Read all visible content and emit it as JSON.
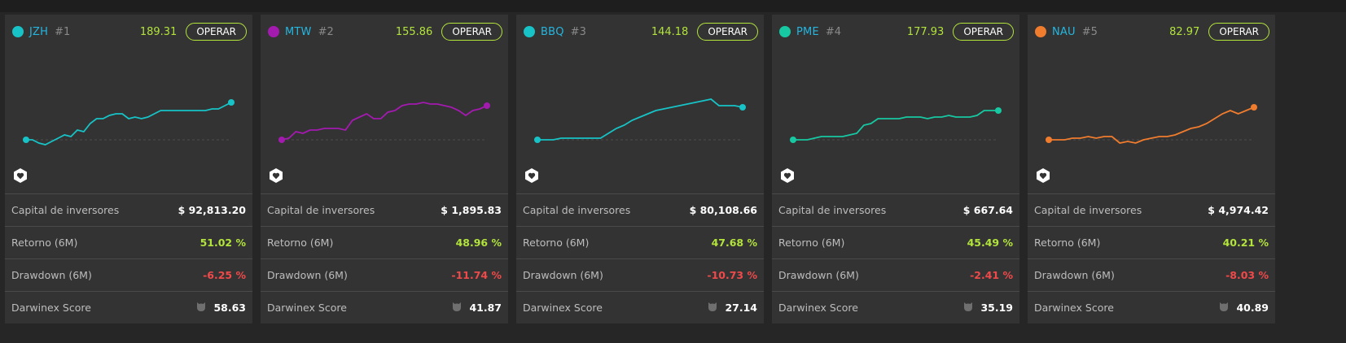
{
  "cards": [
    {
      "symbol": "JZH",
      "rank": "#1",
      "price": "189.31",
      "button": "OPERAR",
      "dot_color": "#17c3c6",
      "line_color": "#17c3c6",
      "spark": [
        20,
        20,
        18,
        17,
        19,
        21,
        23,
        22,
        26,
        25,
        30,
        33,
        33,
        35,
        36,
        36,
        33,
        34,
        33,
        34,
        36,
        38,
        38,
        38,
        38,
        38,
        38,
        38,
        38,
        39,
        39,
        41,
        43
      ],
      "stats": [
        {
          "label": "Capital de inversores",
          "value": "$ 92,813.20",
          "tone": "plain"
        },
        {
          "label": "Retorno (6M)",
          "value": "51.02 %",
          "tone": "pos"
        },
        {
          "label": "Drawdown (6M)",
          "value": "-6.25 %",
          "tone": "neg"
        },
        {
          "label": "Darwinex Score",
          "value": "58.63",
          "tone": "score"
        }
      ]
    },
    {
      "symbol": "MTW",
      "rank": "#2",
      "price": "155.86",
      "button": "OPERAR",
      "dot_color": "#a31aaf",
      "line_color": "#a31aaf",
      "spark": [
        5,
        6,
        10,
        9,
        11,
        11,
        12,
        12,
        12,
        11,
        17,
        19,
        21,
        18,
        18,
        22,
        23,
        26,
        27,
        27,
        28,
        27,
        27,
        26,
        25,
        23,
        20,
        23,
        24,
        26
      ],
      "stats": [
        {
          "label": "Capital de inversores",
          "value": "$ 1,895.83",
          "tone": "plain"
        },
        {
          "label": "Retorno (6M)",
          "value": "48.96 %",
          "tone": "pos"
        },
        {
          "label": "Drawdown (6M)",
          "value": "-11.74 %",
          "tone": "neg"
        },
        {
          "label": "Darwinex Score",
          "value": "41.87",
          "tone": "score"
        }
      ]
    },
    {
      "symbol": "BBQ",
      "rank": "#3",
      "price": "144.18",
      "button": "OPERAR",
      "dot_color": "#17c3c6",
      "line_color": "#17c3c6",
      "spark": [
        10,
        10,
        10,
        11,
        11,
        11,
        11,
        11,
        11,
        14,
        17,
        19,
        22,
        24,
        26,
        28,
        29,
        30,
        31,
        32,
        33,
        34,
        35,
        31,
        31,
        31,
        30
      ],
      "stats": [
        {
          "label": "Capital de inversores",
          "value": "$ 80,108.66",
          "tone": "plain"
        },
        {
          "label": "Retorno (6M)",
          "value": "47.68 %",
          "tone": "pos"
        },
        {
          "label": "Drawdown (6M)",
          "value": "-10.73 %",
          "tone": "neg"
        },
        {
          "label": "Darwinex Score",
          "value": "27.14",
          "tone": "score"
        }
      ]
    },
    {
      "symbol": "PME",
      "rank": "#4",
      "price": "177.93",
      "button": "OPERAR",
      "dot_color": "#17c9a3",
      "line_color": "#17c9a3",
      "spark": [
        20,
        20,
        20,
        21,
        22,
        22,
        22,
        22,
        23,
        24,
        29,
        30,
        33,
        33,
        33,
        33,
        34,
        34,
        34,
        33,
        34,
        34,
        35,
        34,
        34,
        34,
        35,
        38,
        38,
        38
      ],
      "stats": [
        {
          "label": "Capital de inversores",
          "value": "$ 667.64",
          "tone": "plain"
        },
        {
          "label": "Retorno (6M)",
          "value": "45.49 %",
          "tone": "pos"
        },
        {
          "label": "Drawdown (6M)",
          "value": "-2.41 %",
          "tone": "neg"
        },
        {
          "label": "Darwinex Score",
          "value": "35.19",
          "tone": "score"
        }
      ]
    },
    {
      "symbol": "NAU",
      "rank": "#5",
      "price": "82.97",
      "button": "OPERAR",
      "dot_color": "#f07c2e",
      "line_color": "#f07c2e",
      "spark": [
        20,
        20,
        20,
        21,
        21,
        22,
        21,
        22,
        22,
        18,
        19,
        18,
        20,
        21,
        22,
        22,
        23,
        25,
        27,
        28,
        30,
        33,
        36,
        38,
        36,
        38,
        40
      ],
      "stats": [
        {
          "label": "Capital de inversores",
          "value": "$ 4,974.42",
          "tone": "plain"
        },
        {
          "label": "Retorno (6M)",
          "value": "40.21 %",
          "tone": "pos"
        },
        {
          "label": "Drawdown (6M)",
          "value": "-8.03 %",
          "tone": "neg"
        },
        {
          "label": "Darwinex Score",
          "value": "40.89",
          "tone": "score"
        }
      ]
    }
  ]
}
